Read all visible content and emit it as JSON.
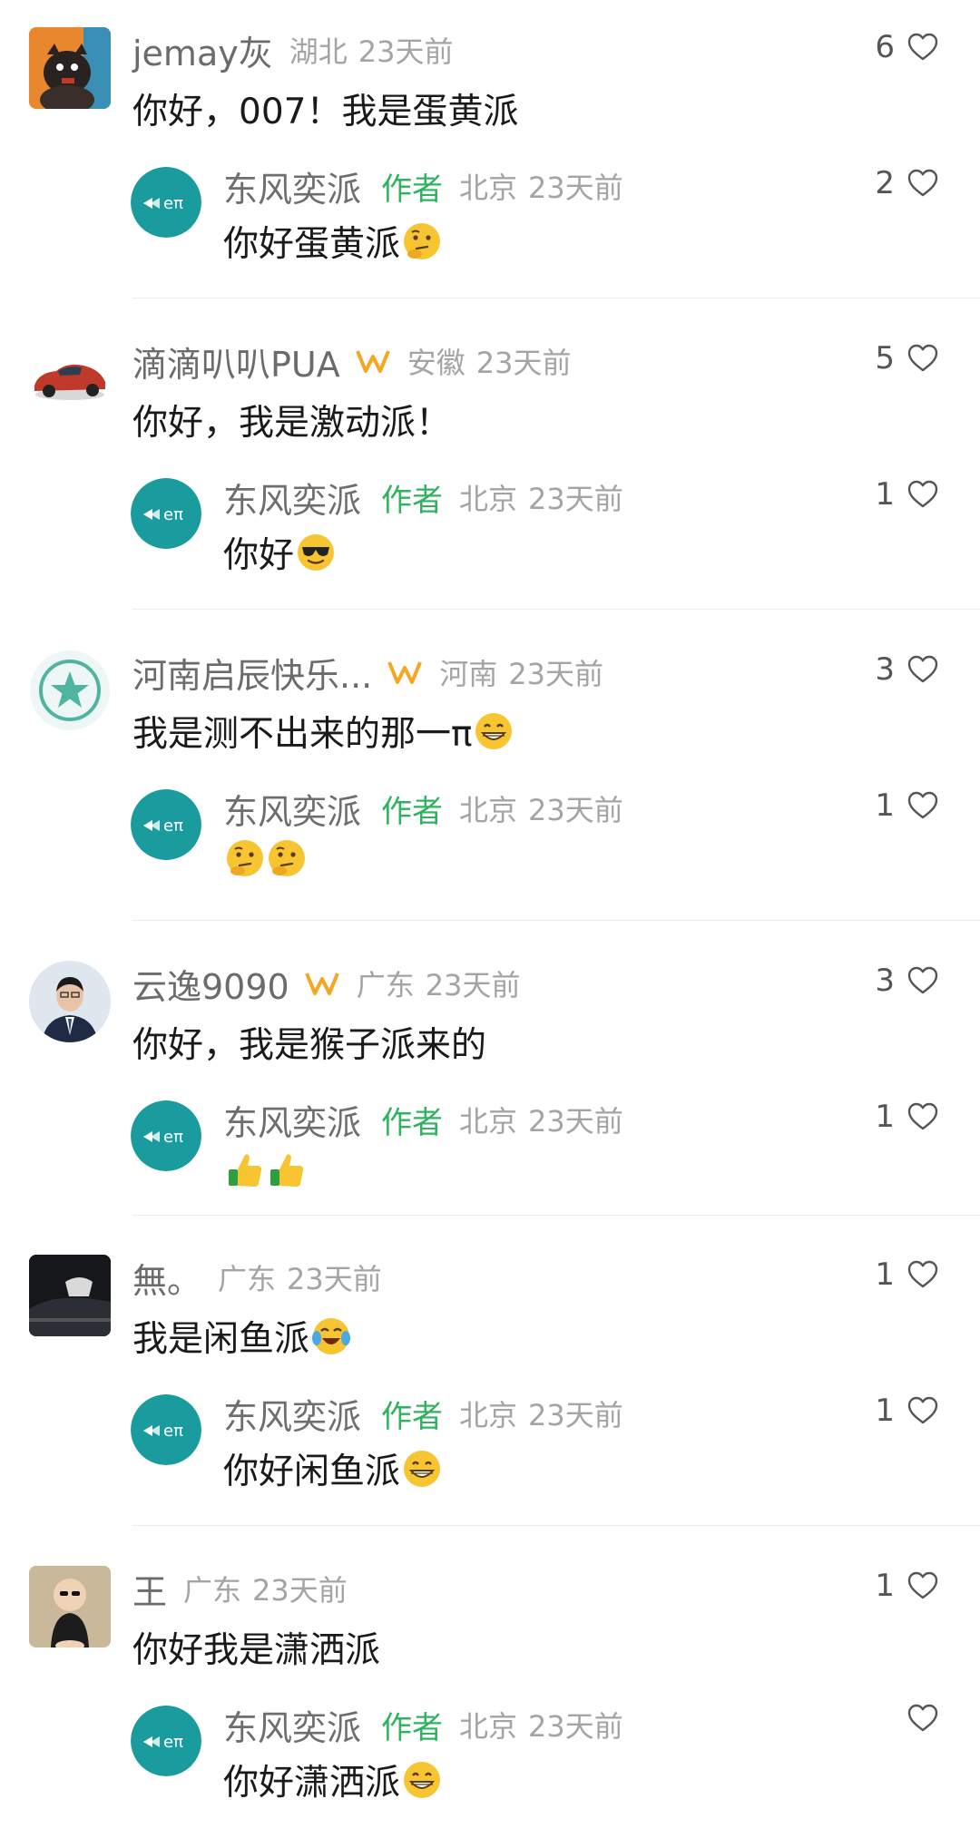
{
  "comments": [
    {
      "username": "jemay灰",
      "location": "湖北",
      "time": "23天前",
      "likes": "6",
      "text": "你好，007！我是蛋黄派",
      "emojis": [],
      "reply": {
        "username": "东风奕派",
        "author_tag": "作者",
        "location": "北京",
        "time": "23天前",
        "likes": "2",
        "text": "你好蛋黄派",
        "emojis": [
          "thinking-emoji"
        ]
      }
    },
    {
      "username": "滴滴叭叭PUA",
      "location": "安徽",
      "time": "23天前",
      "likes": "5",
      "text": "你好，我是激动派！",
      "emojis": [],
      "reply": {
        "username": "东风奕派",
        "author_tag": "作者",
        "location": "北京",
        "time": "23天前",
        "likes": "1",
        "text": "你好",
        "emojis": [
          "sunglasses-emoji"
        ]
      }
    },
    {
      "username": "河南启辰快乐...",
      "location": "河南",
      "time": "23天前",
      "likes": "3",
      "text": "我是测不出来的那一π",
      "emojis": [
        "grin-emoji"
      ],
      "reply": {
        "username": "东风奕派",
        "author_tag": "作者",
        "location": "北京",
        "time": "23天前",
        "likes": "1",
        "text": "",
        "emojis": [
          "thinking-emoji",
          "thinking-emoji"
        ]
      }
    },
    {
      "username": "云逸9090",
      "location": "广东",
      "time": "23天前",
      "likes": "3",
      "text": "你好，我是猴子派来的",
      "emojis": [],
      "reply": {
        "username": "东风奕派",
        "author_tag": "作者",
        "location": "北京",
        "time": "23天前",
        "likes": "1",
        "text": "",
        "emojis": [
          "thumbs-up-emoji",
          "thumbs-up-emoji"
        ]
      }
    },
    {
      "username": "無。",
      "location": "广东",
      "time": "23天前",
      "likes": "1",
      "text": "我是闲鱼派",
      "emojis": [
        "laugh-cry-emoji"
      ],
      "reply": {
        "username": "东风奕派",
        "author_tag": "作者",
        "location": "北京",
        "time": "23天前",
        "likes": "1",
        "text": "你好闲鱼派",
        "emojis": [
          "grin-emoji"
        ]
      }
    },
    {
      "username": "王",
      "location": "广东",
      "time": "23天前",
      "likes": "1",
      "text": "你好我是潇洒派",
      "emojis": [],
      "reply": {
        "username": "东风奕派",
        "author_tag": "作者",
        "location": "北京",
        "time": "23天前",
        "likes": "",
        "text": "你好潇洒派",
        "emojis": [
          "grin-emoji"
        ]
      }
    }
  ],
  "colors": {
    "author_tag": "#2fb35f",
    "brand_avatar": "#1a9c9e",
    "badge": "#f5a623"
  }
}
